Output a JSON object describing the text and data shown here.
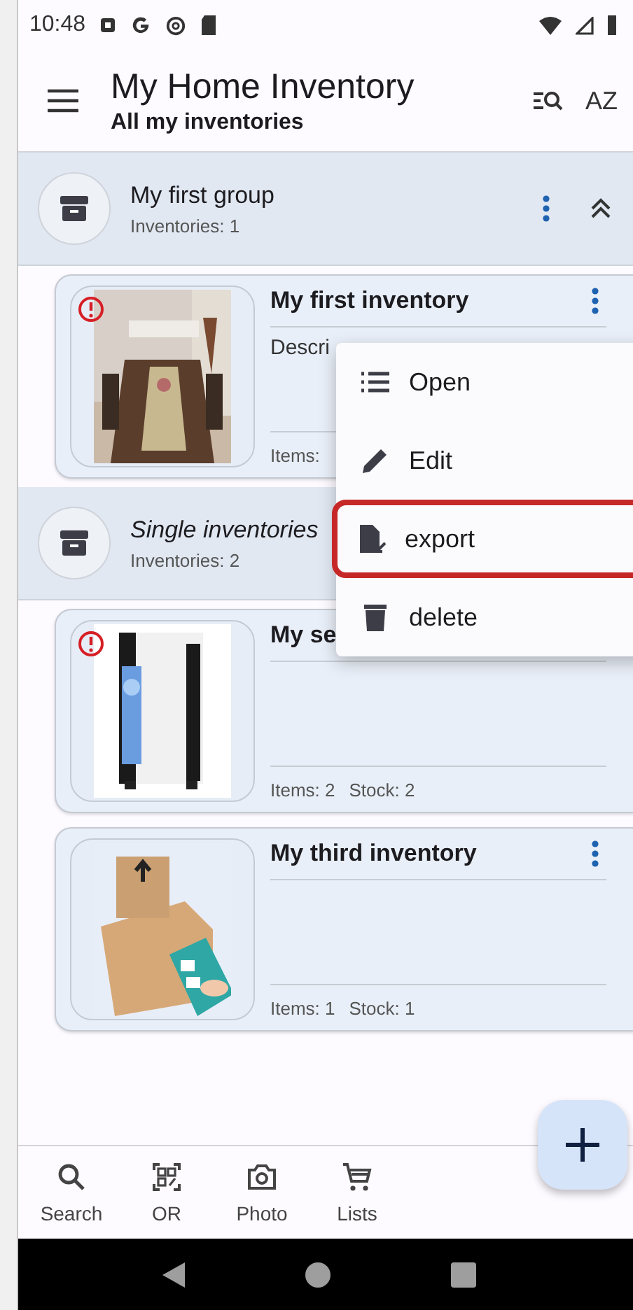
{
  "status_bar": {
    "time": "10:48"
  },
  "app_bar": {
    "title": "My Home Inventory",
    "subtitle": "All my inventories",
    "sort_label": "AZ"
  },
  "groups": [
    {
      "name": "My first group",
      "kind": "group",
      "count": "Inventories: 1",
      "expanded": true,
      "inventories": [
        {
          "title": "My first inventory",
          "description": "Descri",
          "stats": [
            "Items:"
          ],
          "warning": true
        }
      ]
    },
    {
      "name": "Single inventories",
      "kind": "single",
      "count": "Inventories: 2",
      "inventories": [
        {
          "title": "My se",
          "stats": [
            "Items: 2",
            "Stock: 2"
          ],
          "warning": true
        },
        {
          "title": "My third inventory",
          "stats": [
            "Items: 1",
            "Stock: 1"
          ],
          "warning": false
        }
      ]
    }
  ],
  "menu": {
    "items": [
      {
        "label": "Open",
        "highlighted": false
      },
      {
        "label": "Edit",
        "highlighted": false
      },
      {
        "label": "export",
        "highlighted": true
      },
      {
        "label": "delete",
        "highlighted": false
      }
    ]
  },
  "bottom_nav": [
    {
      "label": "Search"
    },
    {
      "label": "OR"
    },
    {
      "label": "Photo"
    },
    {
      "label": "Lists"
    }
  ]
}
